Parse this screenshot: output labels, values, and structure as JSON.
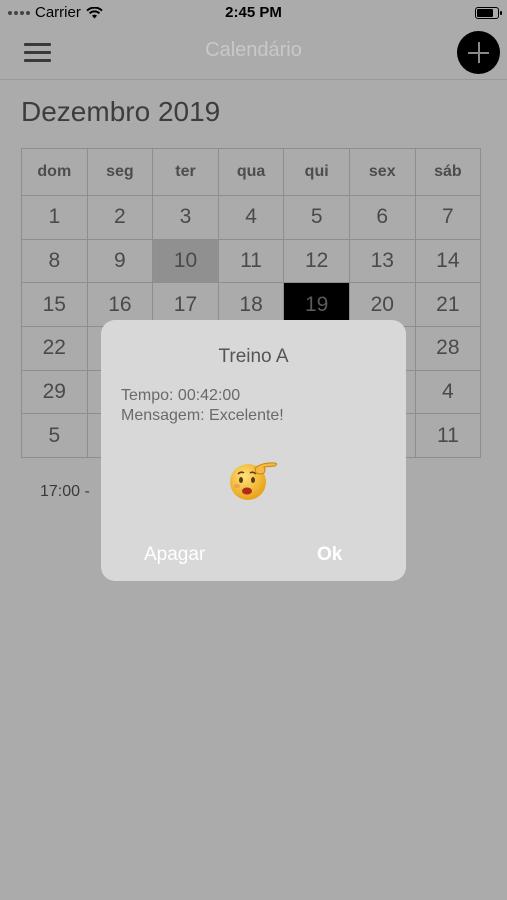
{
  "status_bar": {
    "carrier": "Carrier",
    "time": "2:45 PM",
    "battery_level": 0.9
  },
  "nav": {
    "title": "Calendário"
  },
  "month_title": "Dezembro 2019",
  "calendar": {
    "weekdays": [
      "dom",
      "seg",
      "ter",
      "qua",
      "qui",
      "sex",
      "sáb"
    ],
    "weeks": [
      [
        "1",
        "2",
        "3",
        "4",
        "5",
        "6",
        "7"
      ],
      [
        "8",
        "9",
        "10",
        "11",
        "12",
        "13",
        "14"
      ],
      [
        "15",
        "16",
        "17",
        "18",
        "19",
        "20",
        "21"
      ],
      [
        "22",
        "",
        "",
        "",
        "",
        "",
        "28"
      ],
      [
        "29",
        "",
        "",
        "",
        "",
        "",
        "4"
      ],
      [
        "5",
        "",
        "",
        "",
        "",
        "",
        "11"
      ]
    ],
    "selected_day": "10",
    "today": "19"
  },
  "event": {
    "text": "17:00 -"
  },
  "dialog": {
    "title": "Treino A",
    "line1": "Tempo: 00:42:00",
    "line2": "Mensagem: Excelente!",
    "emoji_icon": "pointing-hand-worried-face-icon",
    "cancel_label": "Apagar",
    "ok_label": "Ok"
  },
  "colors": {
    "overlay_bg": "#ababab",
    "dialog_bg": "#d8d8d8",
    "today_bg": "#000000",
    "selected_bg": "#909090"
  }
}
